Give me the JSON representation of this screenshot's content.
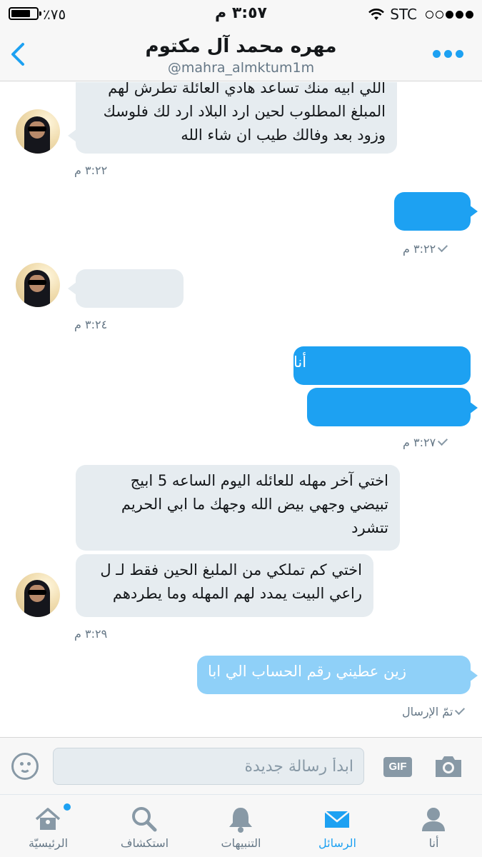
{
  "status_bar": {
    "battery": "٪٧٥",
    "time": "٣:٥٧ م",
    "carrier": "STC"
  },
  "header": {
    "name": "مهره محمد آل مكتوم",
    "handle": "@mahra_almktum1m",
    "back_icon": "chevron-left-icon",
    "more_icon": "more-dots-icon"
  },
  "messages": {
    "m1": {
      "lines": [
        "اللي أبيه منك تساعد هادي العائلة تطرش لهم",
        "المبلغ المطلوب لحين ارد البلاد ارد لك فلوسك",
        "وزود بعد وفالك طيب ان شاء الله"
      ],
      "time": "٣:٢٢ م"
    },
    "m2": {
      "text": "",
      "time": "٣:٢٢ م"
    },
    "m3": {
      "text": "",
      "time": "٣:٢٤ م"
    },
    "m4": {
      "text": "أنا",
      "text2": "",
      "time": "٣:٢٧ م"
    },
    "m5": {
      "lines": [
        "اختي آخر مهله للعائله اليوم الساعه 5 ابيج",
        "تبيضي وجهي بيض الله وجهك ما ابي الحريم",
        "تتشرد"
      ]
    },
    "m6": {
      "lines": [
        "اختي كم تملكي من الملبغ الحين فقط لـ ل",
        "راعي البيت يمدد لهم المهله وما يطردهم"
      ],
      "time": "٣:٢٩ م"
    },
    "m7": {
      "text": "زين عطيني رقم الحساب الي ابا",
      "status": "تمّ الإرسال"
    }
  },
  "composer": {
    "placeholder": "ابدأ رسالة جديدة",
    "gif_label": "GIF"
  },
  "tabs": {
    "home": "الرئيسيّة",
    "explore": "استكشاف",
    "notifications": "التنبيهات",
    "messages": "الرسائل",
    "me": "أنا"
  },
  "colors": {
    "accent": "#1da1f2",
    "incoming_bubble": "#e6ecf0",
    "muted": "#657786"
  }
}
